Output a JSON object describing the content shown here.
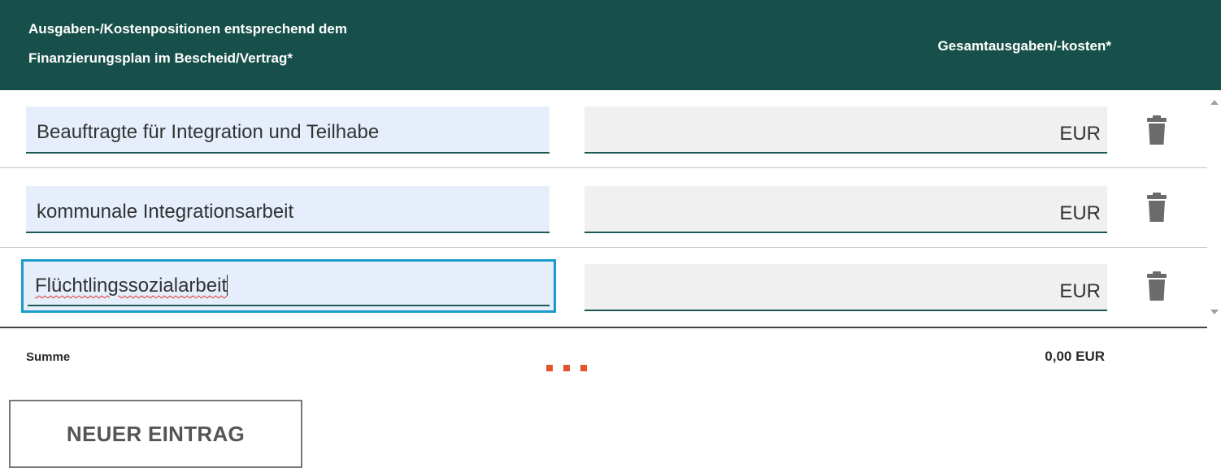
{
  "table": {
    "header": {
      "position_col_line1": "Ausgaben-/Kostenpositionen entsprechend dem",
      "position_col_line2": "Finanzierungsplan im Bescheid/Vertrag*",
      "amount_col": "Gesamtausgaben/-kosten*"
    },
    "rows": [
      {
        "position": "Beauftragte für Integration und Teilhabe",
        "amount": "",
        "currency": "EUR",
        "delete_icon": "trash-icon"
      },
      {
        "position": "kommunale Integrationsarbeit",
        "amount": "",
        "currency": "EUR",
        "delete_icon": "trash-icon"
      },
      {
        "position": "Flüchtlingssozialarbeit",
        "amount": "",
        "currency": "EUR",
        "delete_icon": "trash-icon",
        "focused": true,
        "spellcheck_error": true
      }
    ],
    "sum": {
      "label": "Summe",
      "value": "0,00 EUR"
    },
    "loading_indicator": "loading-dots-icon"
  },
  "actions": {
    "new_entry_label": "NEUER EINTRAG"
  },
  "colors": {
    "header_bg": "#17504a",
    "input_bg": "#e6eefb",
    "amount_bg": "#f0f0f0",
    "focus_border": "#1b9ccb",
    "loading_dots": "#e2542f",
    "spell_error": "#e0332d"
  }
}
